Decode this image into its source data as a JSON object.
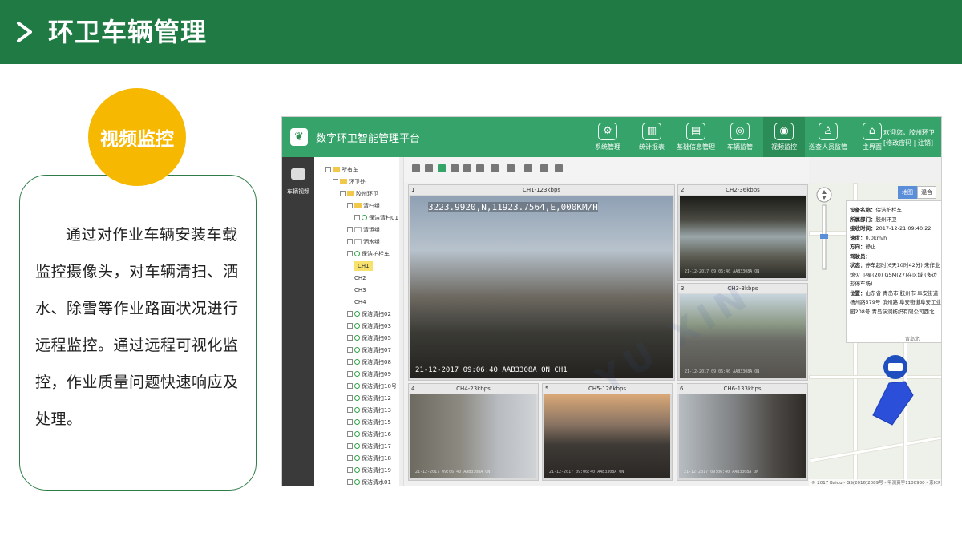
{
  "header": {
    "title": "环卫车辆管理"
  },
  "badge": {
    "label": "视频监控"
  },
  "description": "通过对作业车辆安装车载监控摄像头，对车辆清扫、洒水、除雪等作业路面状况进行远程监控。通过远程可视化监控，作业质量问题快速响应及处理。",
  "app": {
    "title": "数字环卫智能管理平台",
    "nav": [
      {
        "label": "系统管理",
        "icon": "gear-icon"
      },
      {
        "label": "统计报表",
        "icon": "bar-chart-icon"
      },
      {
        "label": "基础信息管理",
        "icon": "document-icon"
      },
      {
        "label": "车辆监管",
        "icon": "dial-icon"
      },
      {
        "label": "视频监控",
        "icon": "camera-icon"
      },
      {
        "label": "巡查人员监管",
        "icon": "person-icon"
      },
      {
        "label": "主界面",
        "icon": "home-icon"
      }
    ],
    "user_greeting": "欢迎您，胶州环卫",
    "user_links": "[修改密码 | 注销]",
    "side_label": "车辆视频"
  },
  "tree": [
    {
      "label": "所有车",
      "indent": 0,
      "kind": "folder"
    },
    {
      "label": "环卫处",
      "indent": 1,
      "kind": "folder"
    },
    {
      "label": "胶州环卫",
      "indent": 2,
      "kind": "folder"
    },
    {
      "label": "清扫组",
      "indent": 3,
      "kind": "folder"
    },
    {
      "label": "保洁清扫01",
      "indent": 4,
      "kind": "vehicle"
    },
    {
      "label": "清运组",
      "indent": 3,
      "kind": "box"
    },
    {
      "label": "洒水组",
      "indent": 3,
      "kind": "box"
    },
    {
      "label": "保洁护栏车",
      "indent": 3,
      "kind": "vehicle"
    },
    {
      "label": "CH1",
      "indent": 4,
      "kind": "channel",
      "selected": true
    },
    {
      "label": "CH2",
      "indent": 4,
      "kind": "channel"
    },
    {
      "label": "CH3",
      "indent": 4,
      "kind": "channel"
    },
    {
      "label": "CH4",
      "indent": 4,
      "kind": "channel"
    },
    {
      "label": "保洁清扫02",
      "indent": 3,
      "kind": "vehicle"
    },
    {
      "label": "保洁清扫03",
      "indent": 3,
      "kind": "vehicle"
    },
    {
      "label": "保洁清扫05",
      "indent": 3,
      "kind": "vehicle"
    },
    {
      "label": "保洁清扫07",
      "indent": 3,
      "kind": "vehicle"
    },
    {
      "label": "保洁清扫08",
      "indent": 3,
      "kind": "vehicle"
    },
    {
      "label": "保洁清扫09",
      "indent": 3,
      "kind": "vehicle"
    },
    {
      "label": "保洁清扫10号",
      "indent": 3,
      "kind": "vehicle"
    },
    {
      "label": "保洁清扫12",
      "indent": 3,
      "kind": "vehicle"
    },
    {
      "label": "保洁清扫13",
      "indent": 3,
      "kind": "vehicle"
    },
    {
      "label": "保洁清扫15",
      "indent": 3,
      "kind": "vehicle"
    },
    {
      "label": "保洁清扫16",
      "indent": 3,
      "kind": "vehicle"
    },
    {
      "label": "保洁清扫17",
      "indent": 3,
      "kind": "vehicle"
    },
    {
      "label": "保洁清扫18",
      "indent": 3,
      "kind": "vehicle"
    },
    {
      "label": "保洁清扫19",
      "indent": 3,
      "kind": "vehicle"
    },
    {
      "label": "保洁清水01",
      "indent": 3,
      "kind": "vehicle"
    }
  ],
  "channels": [
    {
      "num": "1",
      "title": "CH1-123kbps",
      "osd_top": "3223.9920,N,11923.7564,E,000KM/H",
      "osd": "21-12-2017 09:06:40 AAB3308A ON  CH1"
    },
    {
      "num": "2",
      "title": "CH2-36kbps",
      "osd": "21-12-2017 09:06:40 AAB3308A ON"
    },
    {
      "num": "3",
      "title": "CH3-3kbps",
      "osd": "21-12-2017 09:06:40 AAB3308A ON"
    },
    {
      "num": "4",
      "title": "CH4-23kbps",
      "osd": "21-12-2017 09:06:40 AAB3308A ON"
    },
    {
      "num": "5",
      "title": "CH5-126kbps",
      "osd": "21-12-2017 09:06:40 AAB3308A ON"
    },
    {
      "num": "6",
      "title": "CH6-133kbps",
      "osd": "21-12-2017 09:06:40 AAB3308A ON"
    }
  ],
  "map": {
    "toggle": [
      "地图",
      "混合"
    ],
    "info": [
      {
        "k": "设备名称：",
        "v": "保洁护栏车"
      },
      {
        "k": "所属部门：",
        "v": "胶州环卫"
      },
      {
        "k": "接收时间：",
        "v": "2017-12-21 09:40:22"
      },
      {
        "k": "速度：",
        "v": "0.0km/h"
      },
      {
        "k": "方向：",
        "v": "静止"
      },
      {
        "k": "驾驶员：",
        "v": ""
      },
      {
        "k": "状态：",
        "v": "停车超时(6天10时42分) 未作业 熄火 卫星(20) GSM(27)在区域 (多边形停车场)"
      },
      {
        "k": "位置：",
        "v": "山东省 青岛市 胶州市 阜安街道杨州路579号 滨州路 阜安街道阜安工业园208号 青岛演润纺织有限公司西北"
      }
    ],
    "copyright": "© 2017 Baidu - GS(2016)2089号 - 甲测资字1100930 - 京ICP"
  },
  "colors": {
    "header": "#1f7a43",
    "badge": "#f6b800",
    "app_header": "#36a46a",
    "card_border": "#2f7d48"
  }
}
